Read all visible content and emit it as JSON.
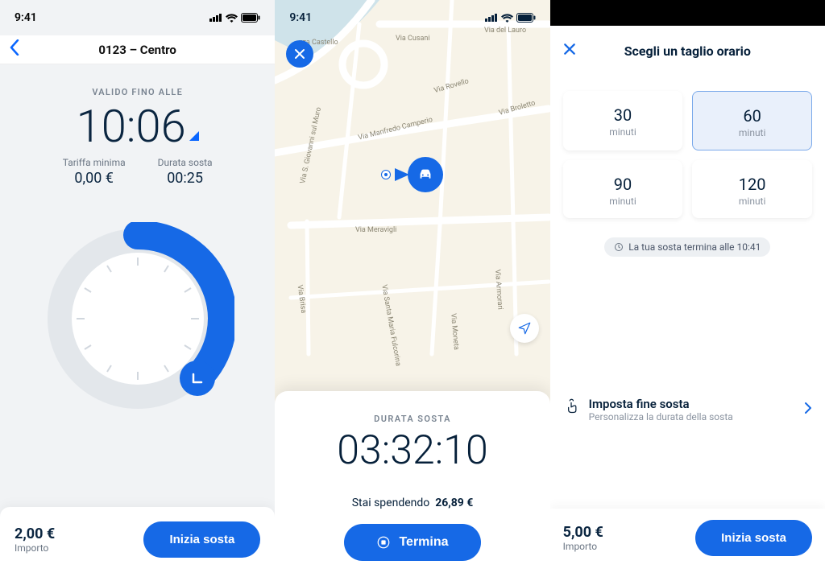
{
  "status": {
    "time": "9:41"
  },
  "screen1": {
    "title": "0123 – Centro",
    "valid_until_label": "VALIDO FINO ALLE",
    "valid_until_time": "10:06",
    "tariff_label": "Tariffa minima",
    "tariff_value": "0,00 €",
    "duration_label": "Durata sosta",
    "duration_value": "00:25",
    "amount_value": "2,00 €",
    "amount_label": "Importo",
    "start_btn": "Inizia sosta"
  },
  "screen2": {
    "streets": {
      "pza_castello": "zza Castello",
      "via_cusani": "Via Cusani",
      "via_del_lauro": "Via del Lauro",
      "via_rovello": "Via Rovello",
      "via_broletto": "Via Broletto",
      "via_manfredo": "Via Manfredo Camperio",
      "via_sgiovanni": "Via S. Giovanni sul Muro",
      "via_meravigli": "Via Meravigli",
      "via_brisa": "Via Brisa",
      "via_smaria": "Via Santa Maria Fulcorina",
      "via_armorari": "Via Armorari",
      "via_moneta": "Via Moneta"
    },
    "card": {
      "label": "DURATA SOSTA",
      "timer": "03:32:10",
      "spending_prefix": "Stai spendendo",
      "spending_value": "26,89 €",
      "stop_btn": "Termina"
    }
  },
  "screen3": {
    "title": "Scegli un taglio orario",
    "options": [
      {
        "n": "30",
        "u": "minuti"
      },
      {
        "n": "60",
        "u": "minuti"
      },
      {
        "n": "90",
        "u": "minuti"
      },
      {
        "n": "120",
        "u": "minuti"
      }
    ],
    "selected_index": 1,
    "chip": "La tua sosta termina alle 10:41",
    "set_end_title": "Imposta fine sosta",
    "set_end_sub": "Personalizza la durata della sosta",
    "amount_value": "5,00 €",
    "amount_label": "Importo",
    "start_btn": "Inizia sosta"
  }
}
